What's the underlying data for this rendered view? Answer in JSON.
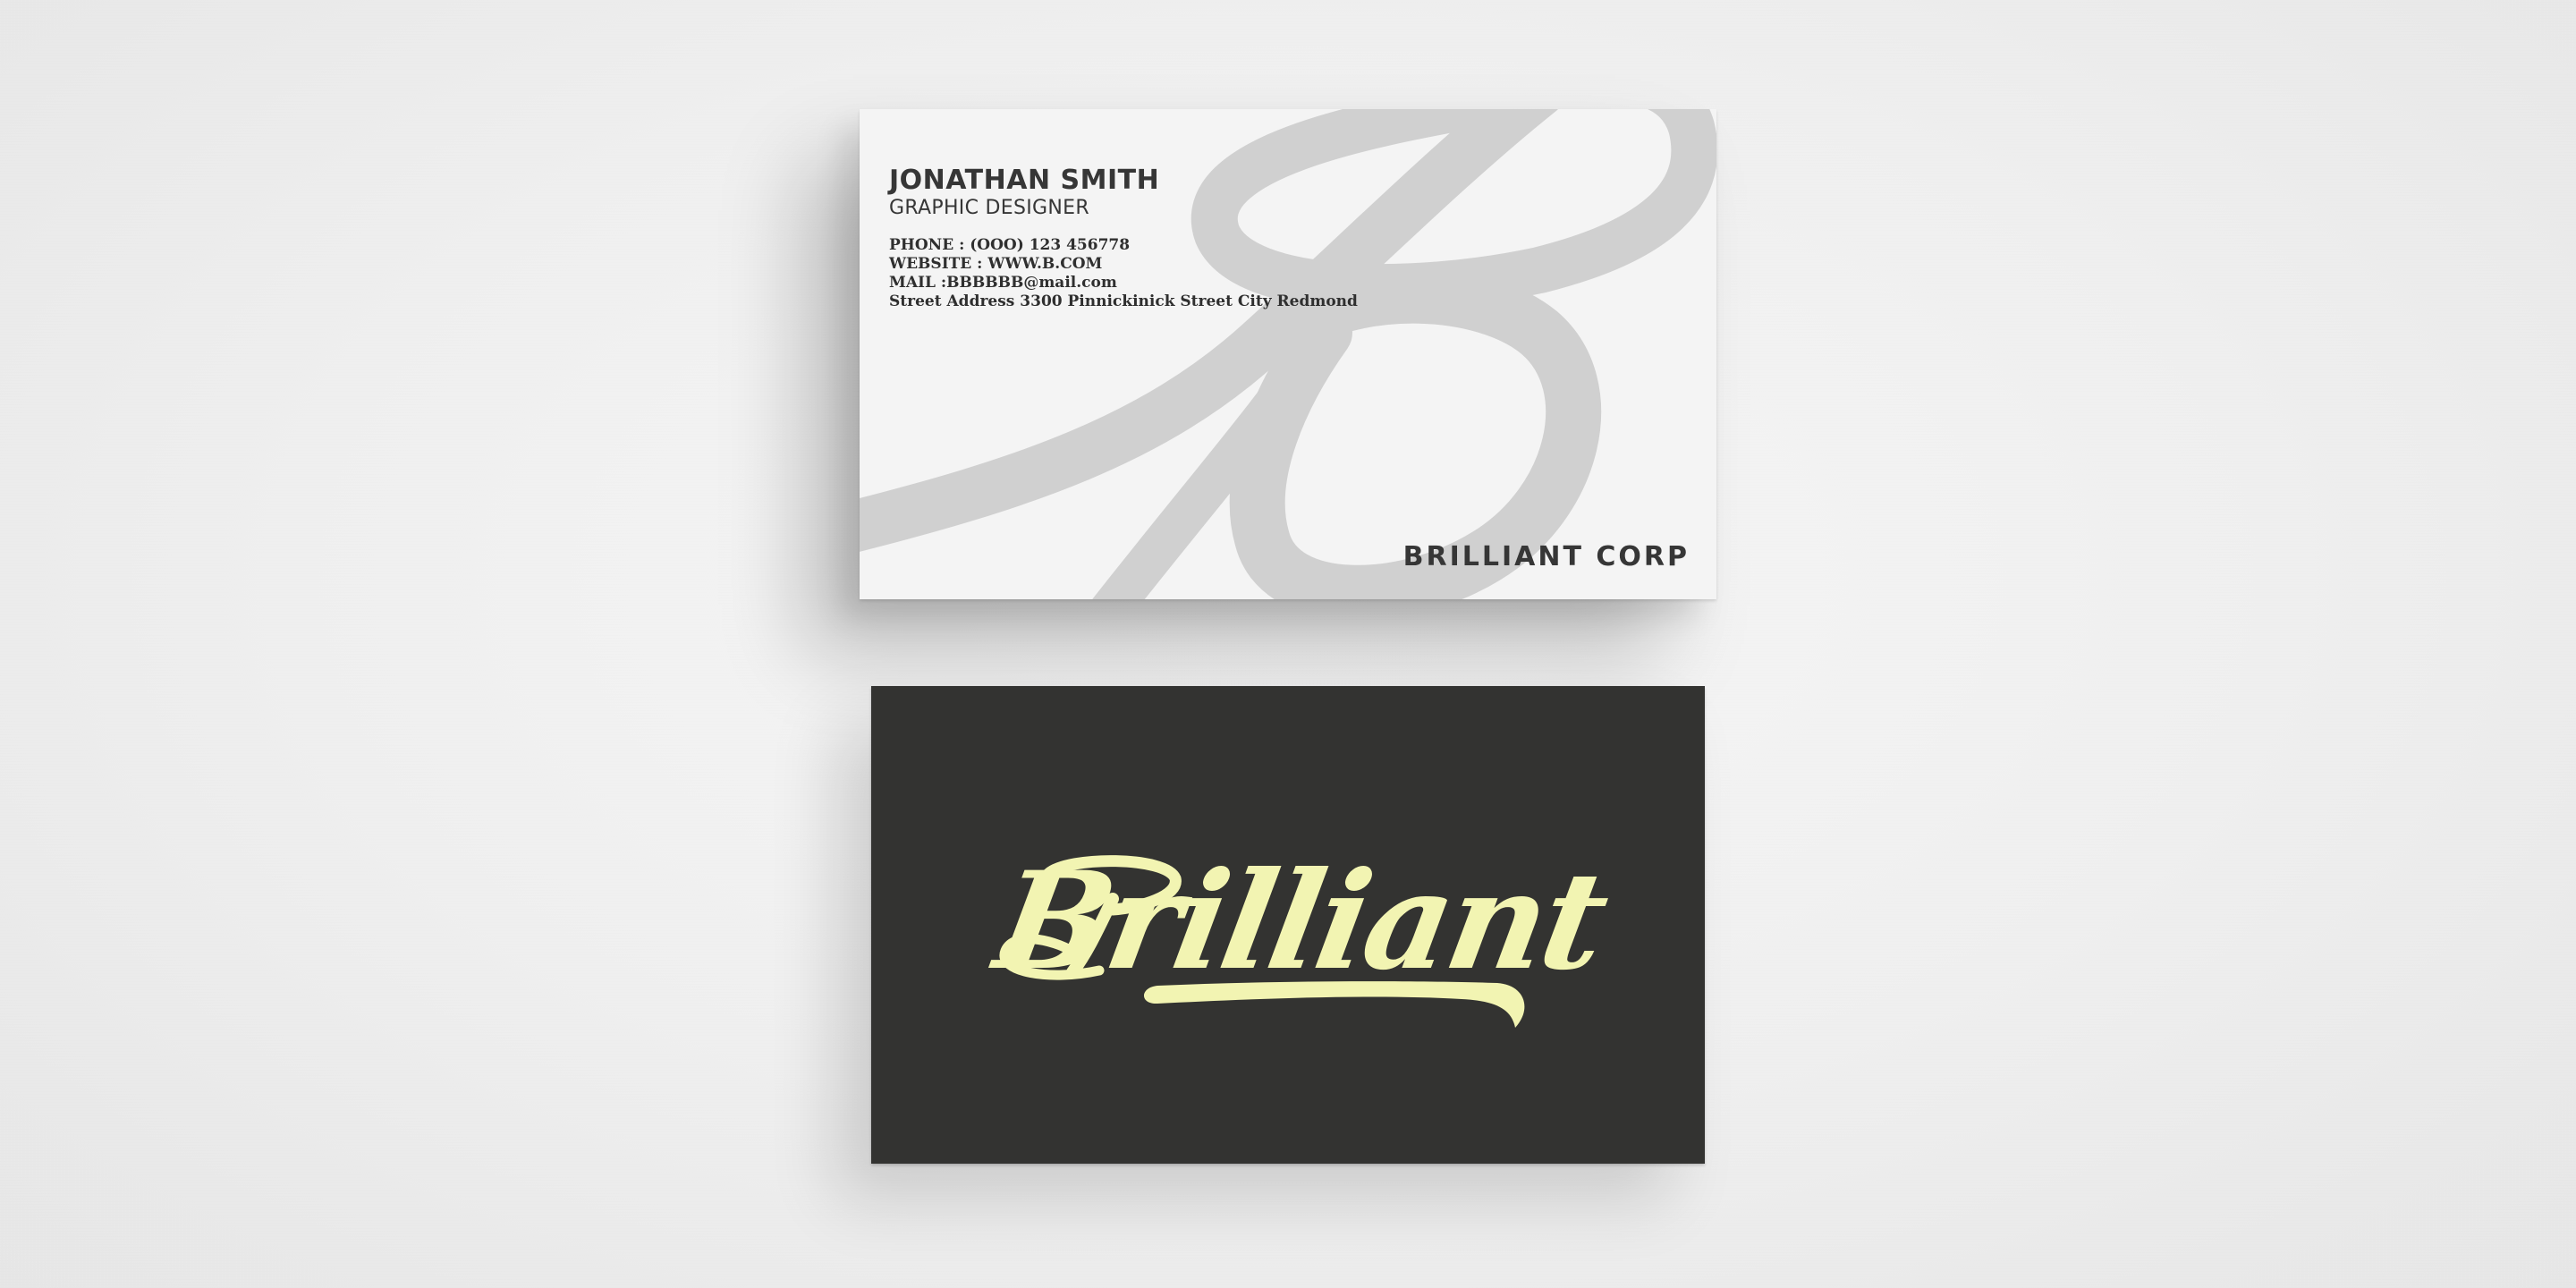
{
  "front": {
    "name": "JONATHAN SMITH",
    "title": "GRAPHIC DESIGNER",
    "phone": "PHONE : (OOO) 123 456778",
    "website": "WEBSITE : WWW.B.COM",
    "mail": "MAIL :BBBBBB@mail.com",
    "address": "Street Address 3300 Pinnickinick Street City Redmond",
    "company": "BRILLIANT CORP",
    "monogram_color": "#d0d0d0",
    "card_color": "#f4f4f4",
    "text_color": "#363636"
  },
  "back": {
    "logo_text": "Brilliant",
    "card_color": "#333331",
    "logo_color": "#f2f4b2"
  }
}
